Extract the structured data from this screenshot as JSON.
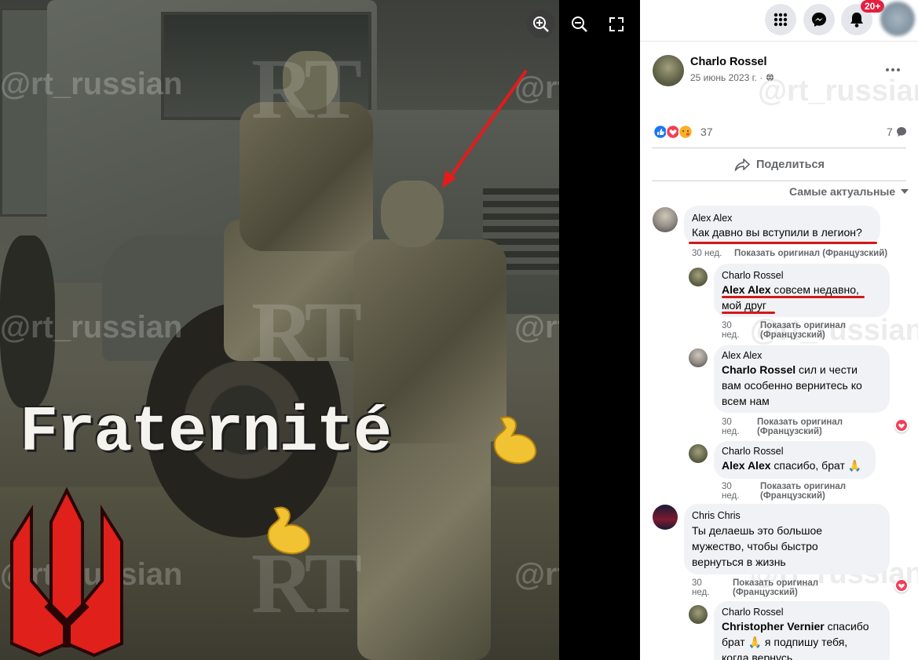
{
  "viewer": {
    "overlay_text": "Fraternité",
    "watermark": "@rt_russian",
    "rt_logo": "RT",
    "controls": {
      "zoom_in_icon": "zoom-in-icon",
      "zoom_out_icon": "zoom-out-icon",
      "fullscreen_icon": "fullscreen-icon"
    }
  },
  "topbar": {
    "menu_icon": "grid-menu-icon",
    "messenger_icon": "messenger-icon",
    "notifications_icon": "bell-icon",
    "notifications_badge": "20+"
  },
  "post": {
    "author": "Charlo Rossel",
    "date": "25 июнь 2023 г. ·",
    "privacy_icon": "globe-icon",
    "more_icon": "more-icon",
    "reactions_count": "37",
    "comments_count": "7",
    "share_label": "Поделиться",
    "sort_label": "Самые актуальные"
  },
  "comments": [
    {
      "author": "Alex Alex",
      "text": "Как давно вы вступили в легион?",
      "time": "30 нед.",
      "original": "Показать оригинал (Французский)"
    },
    {
      "author": "Charlo Rossel",
      "mention": "Alex Alex",
      "text_1": " совсем недавно,",
      "text_2": "мой друг",
      "time_1": "30",
      "time_2": "нед.",
      "original_1": "Показать оригинал",
      "original_2": "(Французский)"
    },
    {
      "author": "Alex Alex",
      "mention": "Charlo Rossel",
      "text_1": " сил и чести",
      "text_2": "вам особенно вернитесь ко",
      "text_3": "всем нам",
      "time_1": "30",
      "time_2": "нед.",
      "original_1": "Показать оригинал",
      "original_2": "(Французский)"
    },
    {
      "author": "Charlo Rossel",
      "mention": "Alex Alex",
      "text": " спасибо, брат 🙏",
      "time_1": "30",
      "time_2": "нед.",
      "original_1": "Показать оригинал",
      "original_2": "(Французский)"
    },
    {
      "author": "Chris Chris",
      "text_1": "Ты делаешь это большое",
      "text_2": "мужество, чтобы быстро",
      "text_3": "вернуться в жизнь",
      "time_1": "30",
      "time_2": "нед.",
      "original_1": "Показать оригинал",
      "original_2": "(Французский)"
    },
    {
      "author": "Charlo Rossel",
      "mention": "Christopher Vernier",
      "text_1": " спасибо",
      "text_2": "брат 🙏 я подпишу тебя,",
      "text_3": "когда вернусь"
    }
  ],
  "colors": {
    "accent": "#1877f2",
    "annotation_red": "#d31818",
    "bubble": "#f0f2f5",
    "badge": "#e41e3f"
  }
}
